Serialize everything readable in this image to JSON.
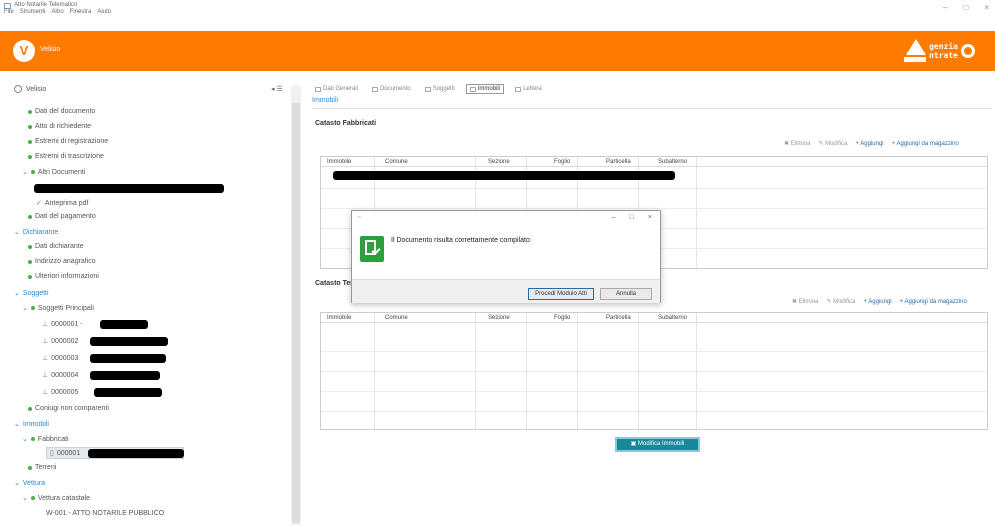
{
  "window": {
    "title": "Atto Notarile Telematico",
    "menu": [
      "File",
      "Strumenti",
      "Altro",
      "Finestra",
      "Aiuto"
    ]
  },
  "header": {
    "logo_letter": "V",
    "logo_text": "Velisio",
    "brand_line1": "genzia",
    "brand_line2": "ntrate"
  },
  "tree": {
    "root": "Velisio",
    "collapse_label": "◂ ☰",
    "items": {
      "dati_documento": "Dati del documento",
      "atto_richiedente": "Atto di richiedente",
      "estremi_registrazione": "Estremi di registrazione",
      "estremi_trascrizione": "Estremi di trascrizione",
      "altri_documenti": "Altri Documenti",
      "anteprima_pdf": "Anteprima pdf",
      "dati_pagamento": "Dati del pagamento",
      "dichiarante_section": "Dichiarante",
      "dati_dichiarante": "Dati dichiarante",
      "indirizzo_anagrafico": "Indirizzo anagrafico",
      "ulteriori_informazioni": "Ulteriori informazioni",
      "soggetti_section": "Soggetti",
      "soggetti_principali": "Soggetti Principali",
      "s1": "0000001 -",
      "s2": "0000002",
      "s3": "0000003",
      "s4": "0000004",
      "s5": "0000005",
      "coniugi": "Coniugi non comparenti",
      "immobili_section": "Immobili",
      "fabbricati": "Fabbricati",
      "f1": "000001",
      "terreni": "Terreni",
      "vettura_section": "Vettura",
      "vettura_catastale": "Vettura catastale",
      "atto_item": "W-001 - ATTO NOTARILE PUBBLICO"
    }
  },
  "tabs": [
    "Dati Generali",
    "Documento",
    "Soggetti",
    "Immobili",
    "Lettera"
  ],
  "active_tab_index": 3,
  "breadcrumb": "Immobili",
  "fabbricati": {
    "title": "Catasto Fabbricati",
    "actions": [
      "Elimina",
      "Modifica",
      "Aggiungi",
      "Aggiungi da magazzino"
    ],
    "columns": [
      "Immobile",
      "Comune",
      "Sezione",
      "Foglio",
      "Particella",
      "Subalterno"
    ]
  },
  "terreni": {
    "title": "Catasto Terreni",
    "actions": [
      "Elimina",
      "Modifica",
      "Aggiungi",
      "Aggiungi da magazzino"
    ],
    "columns": [
      "Immobile",
      "Comune",
      "Sezione",
      "Foglio",
      "Particella",
      "Subalterno"
    ]
  },
  "modify_button": "Modifica Immobili",
  "modal": {
    "title": "",
    "message": "Il Documento risulta correttamente compilato",
    "ok_label": "Procedi Modulo Atti",
    "cancel_label": "Annulla"
  },
  "colors": {
    "header": "#ff7b00",
    "accent": "#2a8bd0",
    "success": "#2e9e3e",
    "button": "#17899a"
  }
}
